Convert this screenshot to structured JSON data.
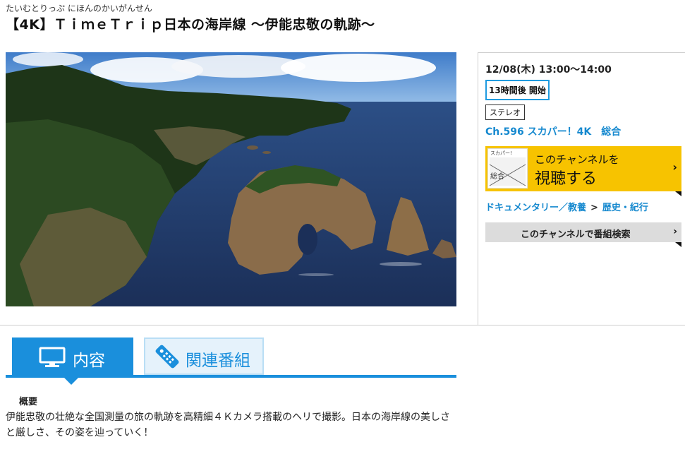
{
  "program": {
    "ruby": "たいむとりっぷ にほんのかいがんせん",
    "title": "【4K】ＴｉｍｅＴｒｉｐ日本の海岸線 〜伊能忠敬の軌跡〜"
  },
  "hero": {
    "image": "coastal-cliffs-photo"
  },
  "broadcast": {
    "datetime": "12/08(木) 13:00〜14:00",
    "countdown": "13時間後 開始",
    "audio": "ステレオ",
    "channel": "Ch.596 スカパー！4K　総合"
  },
  "watch": {
    "thumb_brand": "スカパー!",
    "thumb_label": "総合",
    "line1": "このチャンネルを",
    "line2": "視聴する",
    "chevron": "›"
  },
  "genre": {
    "primary": "ドキュメンタリー／教養",
    "separator": ">",
    "secondary": "歴史・紀行"
  },
  "search": {
    "label": "このチャンネルで番組検索",
    "chevron": "›"
  },
  "tabs": [
    {
      "label": "内容",
      "icon": "tv-icon",
      "active": true
    },
    {
      "label": "関連番組",
      "icon": "remote-icon",
      "active": false
    }
  ],
  "overview": {
    "heading": "概要",
    "text": "伊能忠敬の壮絶な全国測量の旅の軌跡を高精細４Ｋカメラ搭載のヘリで撮影。日本の海岸線の美しさと厳しさ、その姿を辿っていく！"
  },
  "colors": {
    "accent": "#1a8fdc",
    "watch_button": "#f7c300",
    "link": "#1689cf"
  }
}
